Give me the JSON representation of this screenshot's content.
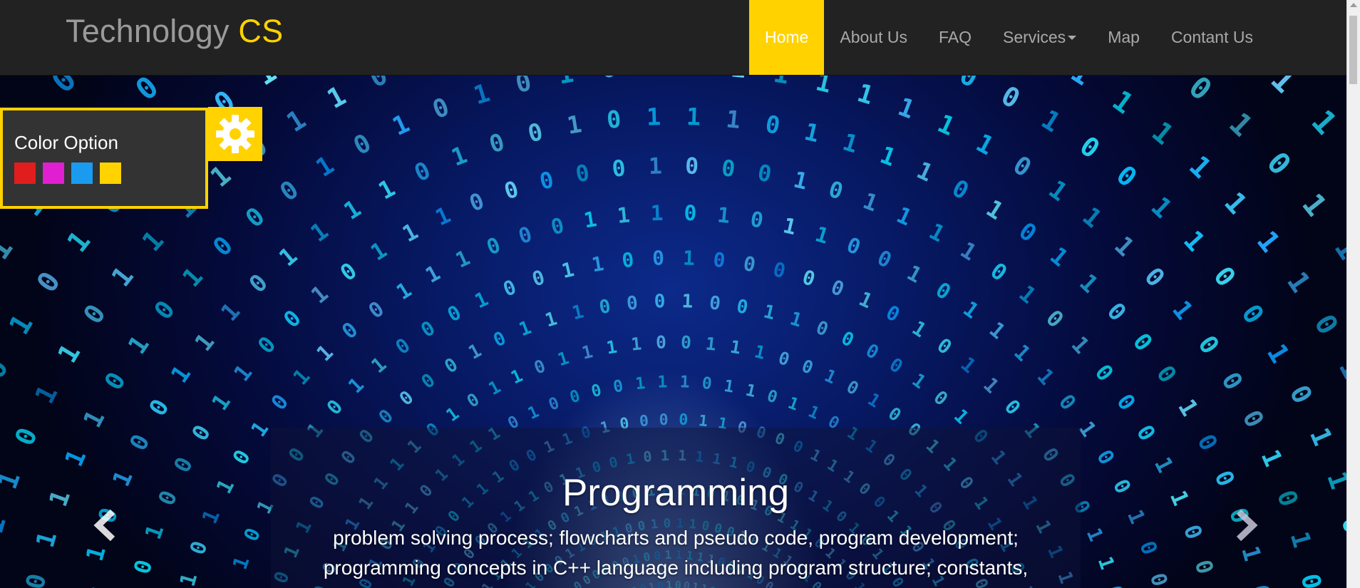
{
  "brand": {
    "name": "Technology",
    "accent": "CS"
  },
  "nav": {
    "items": [
      {
        "label": "Home",
        "active": true
      },
      {
        "label": "About Us"
      },
      {
        "label": "FAQ"
      },
      {
        "label": "Services",
        "dropdown": true
      },
      {
        "label": "Map"
      },
      {
        "label": "Contant Us"
      }
    ]
  },
  "color_option": {
    "title": "Color Option",
    "swatches": [
      "#e11d1d",
      "#e020d0",
      "#1a9bf0",
      "#ffd200"
    ],
    "toggle_icon": "gear-icon"
  },
  "carousel": {
    "slide_title": "Programming",
    "slide_lines": [
      "problem solving process; flowcharts and pseudo code, program development;",
      "programming concepts in C++ language including program structure; constants,"
    ],
    "prev_icon": "chevron-left-icon",
    "next_icon": "chevron-right-icon"
  },
  "colors": {
    "accent": "#ffd200",
    "navbar": "#222222",
    "panel": "#333333"
  }
}
